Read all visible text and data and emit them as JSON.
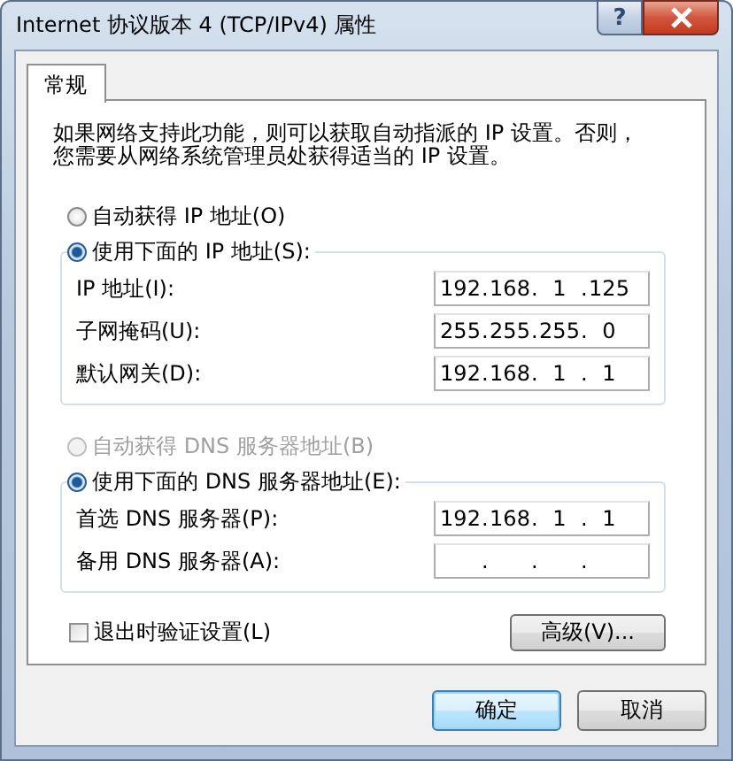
{
  "window": {
    "title": "Internet 协议版本 4 (TCP/IPv4) 属性",
    "help_button": "?"
  },
  "tabs": [
    {
      "label": "常规",
      "selected": true
    }
  ],
  "description": "如果网络支持此功能，则可以获取自动指派的 IP 设置。否则，您需要从网络系统管理员处获得适当的 IP 设置。",
  "ip_section": {
    "options": [
      {
        "label": "自动获得 IP 地址(O)",
        "selected": false,
        "disabled": false
      },
      {
        "label": "使用下面的 IP 地址(S):",
        "selected": true,
        "disabled": false
      }
    ],
    "fields": [
      {
        "label": "IP 地址(I):",
        "separator": ".",
        "octets": [
          "192",
          "168",
          "1",
          "125"
        ]
      },
      {
        "label": "子网掩码(U):",
        "separator": ".",
        "octets": [
          "255",
          "255",
          "255",
          "0"
        ]
      },
      {
        "label": "默认网关(D):",
        "separator": ".",
        "octets": [
          "192",
          "168",
          "1",
          "1"
        ]
      }
    ]
  },
  "dns_section": {
    "options": [
      {
        "label": "自动获得 DNS 服务器地址(B)",
        "selected": false,
        "disabled": true
      },
      {
        "label": "使用下面的 DNS 服务器地址(E):",
        "selected": true,
        "disabled": false
      }
    ],
    "fields": [
      {
        "label": "首选 DNS 服务器(P):",
        "separator": ".",
        "octets": [
          "192",
          "168",
          "1",
          "1"
        ]
      },
      {
        "label": "备用 DNS 服务器(A):",
        "separator": "."
      }
    ]
  },
  "verify_on_exit": {
    "label": "退出时验证设置(L)",
    "checked": false
  },
  "advanced_button": "高级(V)...",
  "buttons": [
    {
      "label": "确定",
      "default": true
    },
    {
      "label": "取消",
      "default": false
    }
  ]
}
